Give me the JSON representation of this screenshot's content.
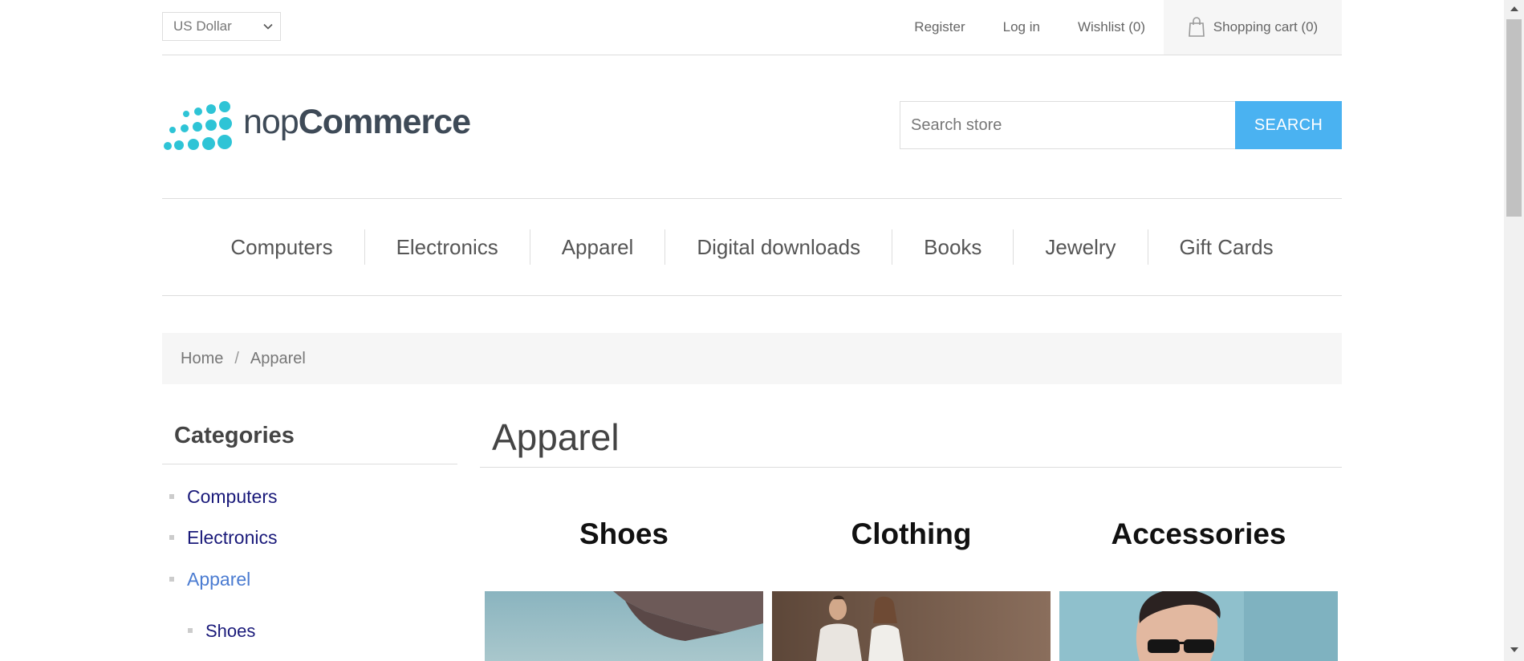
{
  "header": {
    "currency": {
      "selected": "US Dollar"
    },
    "links": {
      "register": "Register",
      "login": "Log in",
      "wishlist": "Wishlist (0)",
      "cart": "Shopping cart (0)"
    }
  },
  "logo": {
    "text_light": "nop",
    "text_bold": "Commerce",
    "dot_color": "#2ec4d6"
  },
  "search": {
    "placeholder": "Search store",
    "button_label": "SEARCH",
    "button_color": "#4ab2f1"
  },
  "top_menu": {
    "items": [
      {
        "label": "Computers"
      },
      {
        "label": "Electronics"
      },
      {
        "label": "Apparel"
      },
      {
        "label": "Digital downloads"
      },
      {
        "label": "Books"
      },
      {
        "label": "Jewelry"
      },
      {
        "label": "Gift Cards"
      }
    ]
  },
  "breadcrumb": {
    "home": "Home",
    "separator": "/",
    "current": "Apparel"
  },
  "sidebar": {
    "title": "Categories",
    "items": [
      {
        "label": "Computers"
      },
      {
        "label": "Electronics"
      },
      {
        "label": "Apparel"
      },
      {
        "label": "Shoes"
      }
    ]
  },
  "main": {
    "title": "Apparel",
    "subcategories": [
      {
        "title": "Shoes"
      },
      {
        "title": "Clothing"
      },
      {
        "title": "Accessories"
      }
    ]
  }
}
